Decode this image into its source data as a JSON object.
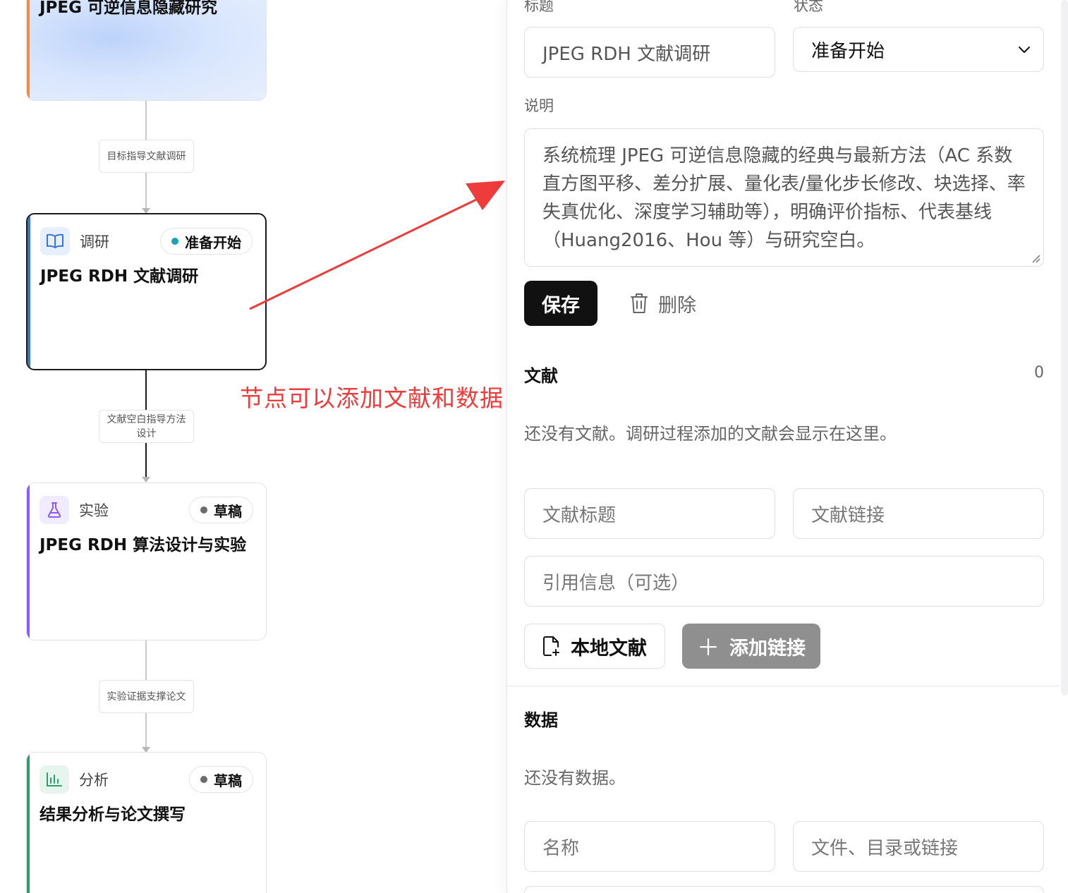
{
  "canvas": {
    "root": {
      "title": "JPEG 可逆信息隐藏研究"
    },
    "edges": [
      {
        "label": "目标指导文献调研"
      },
      {
        "label": "文献空白指导方法设计"
      },
      {
        "label": "实验证据支撑论文"
      }
    ],
    "nodes": [
      {
        "kind": "调研",
        "status": "准备开始",
        "title": "JPEG RDH 文献调研",
        "accent": "#3b74d8",
        "status_color": "#1aa1b5"
      },
      {
        "kind": "实验",
        "status": "草稿",
        "title": "JPEG RDH 算法设计与实验",
        "accent": "#8b5cf6",
        "status_color": "#6b6b6b"
      },
      {
        "kind": "分析",
        "status": "草稿",
        "title": "结果分析与论文撰写",
        "accent": "#2f9e6a",
        "status_color": "#6b6b6b"
      }
    ],
    "annotation": "节点可以添加文献和数据"
  },
  "panel": {
    "title_label": "标题",
    "status_label": "状态",
    "title_value": "JPEG RDH 文献调研",
    "status_value": "准备开始",
    "desc_label": "说明",
    "desc_value": "系统梳理 JPEG 可逆信息隐藏的经典与最新方法（AC 系数直方图平移、差分扩展、量化表/量化步长修改、块选择、率失真优化、深度学习辅助等），明确评价指标、代表基线（Huang2016、Hou 等）与研究空白。",
    "save": "保存",
    "delete": "删除",
    "refs": {
      "title": "文献",
      "count": "0",
      "empty": "还没有文献。调研过程添加的文献会显示在这里。",
      "ref_title_placeholder": "文献标题",
      "ref_link_placeholder": "文献链接",
      "citation_placeholder": "引用信息（可选）",
      "local_button": "本地文献",
      "add_link_button": "添加链接"
    },
    "data": {
      "title": "数据",
      "empty": "还没有数据。",
      "name_placeholder": "名称",
      "path_placeholder": "文件、目录或链接"
    }
  }
}
